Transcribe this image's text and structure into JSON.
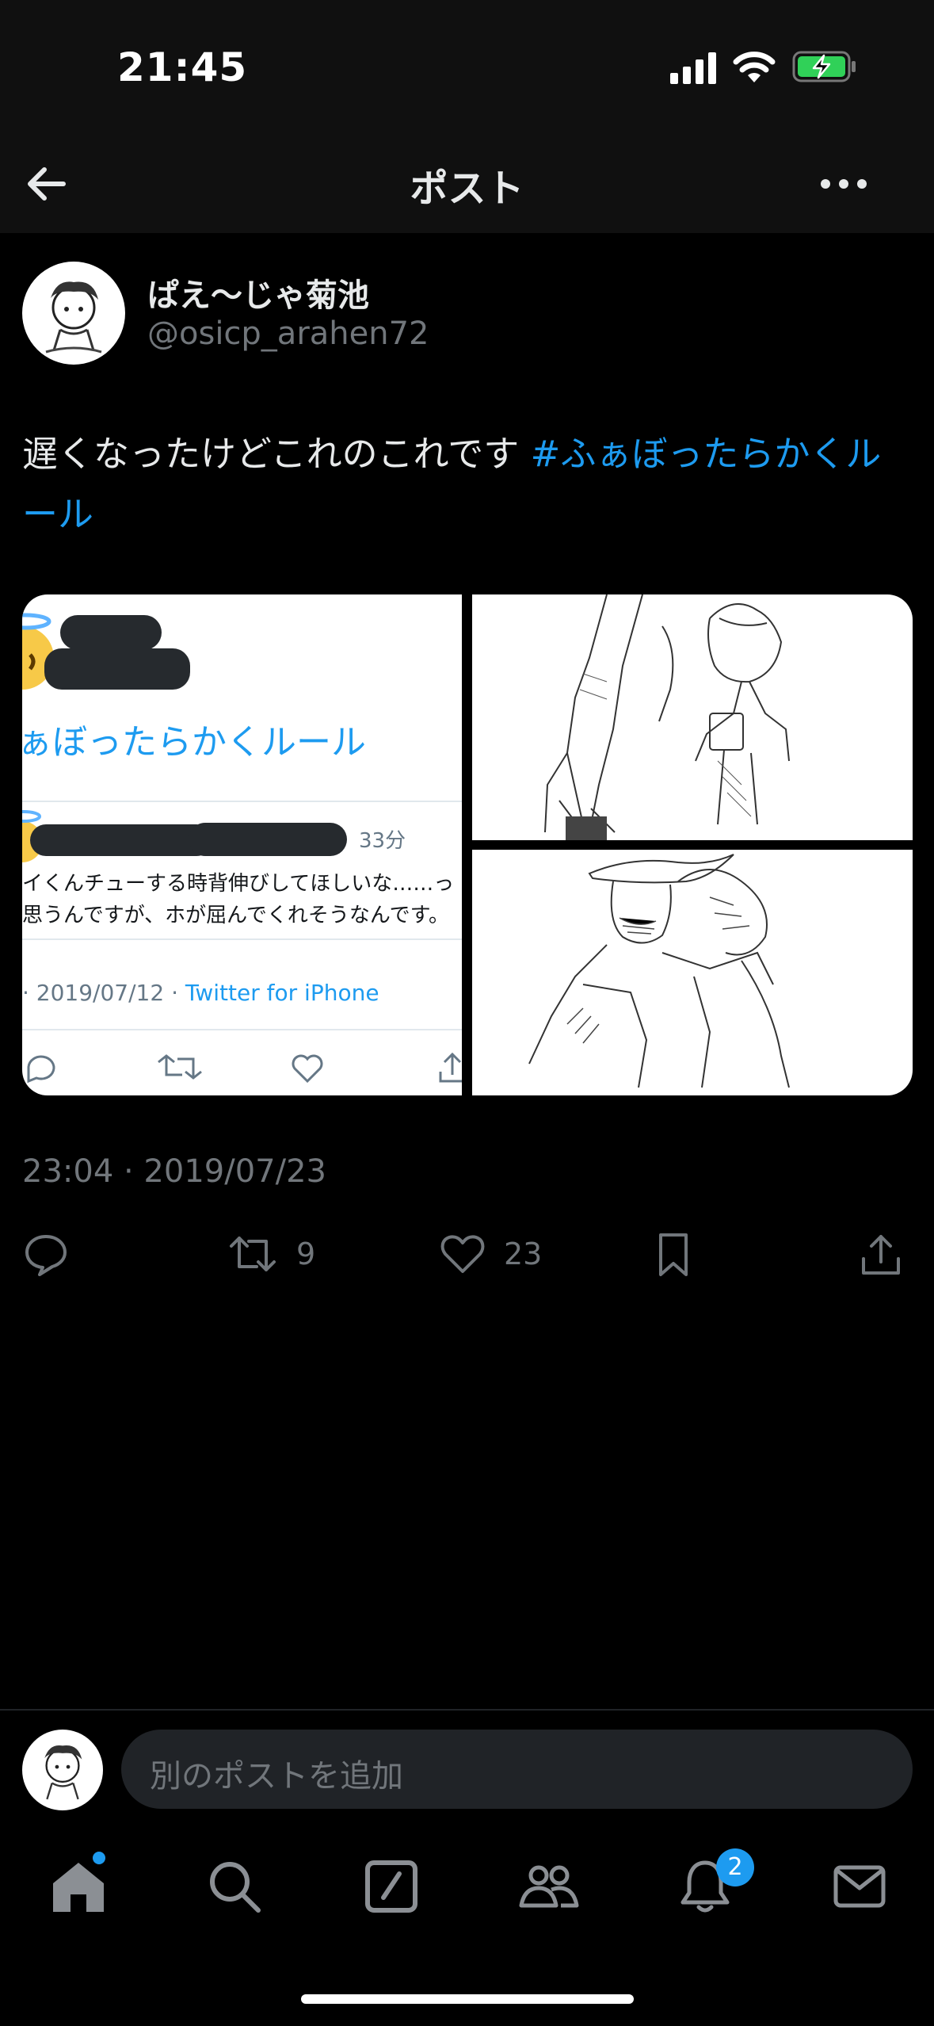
{
  "status_bar": {
    "time": "21:45"
  },
  "nav": {
    "title": "ポスト"
  },
  "author": {
    "display_name": "ぱえ〜じゃ菊池",
    "handle": "@osicp_arahen72"
  },
  "post": {
    "text": "遅くなったけどこれのこれです ",
    "hashtag": "#ふぁぼったらかくルール",
    "timestamp": "23:04 · 2019/07/23"
  },
  "media": {
    "embedded_screenshot": {
      "hashtag": "ぁぼったらかくルール",
      "minutes": "33分",
      "line1": "イくんチューする時背伸びしてほしいな……っ",
      "line2": "思うんですが、ホが屈んでくれそうなんです。",
      "date": "· 2019/07/12 · ",
      "source": "Twitter for iPhone"
    }
  },
  "actions": {
    "retweets": "9",
    "likes": "23"
  },
  "reply": {
    "placeholder": "別のポストを追加"
  },
  "tabs": {
    "notifications_badge": "2"
  },
  "colors": {
    "accent": "#1d9bf0",
    "background": "#000000",
    "secondary_text": "#71767b"
  }
}
